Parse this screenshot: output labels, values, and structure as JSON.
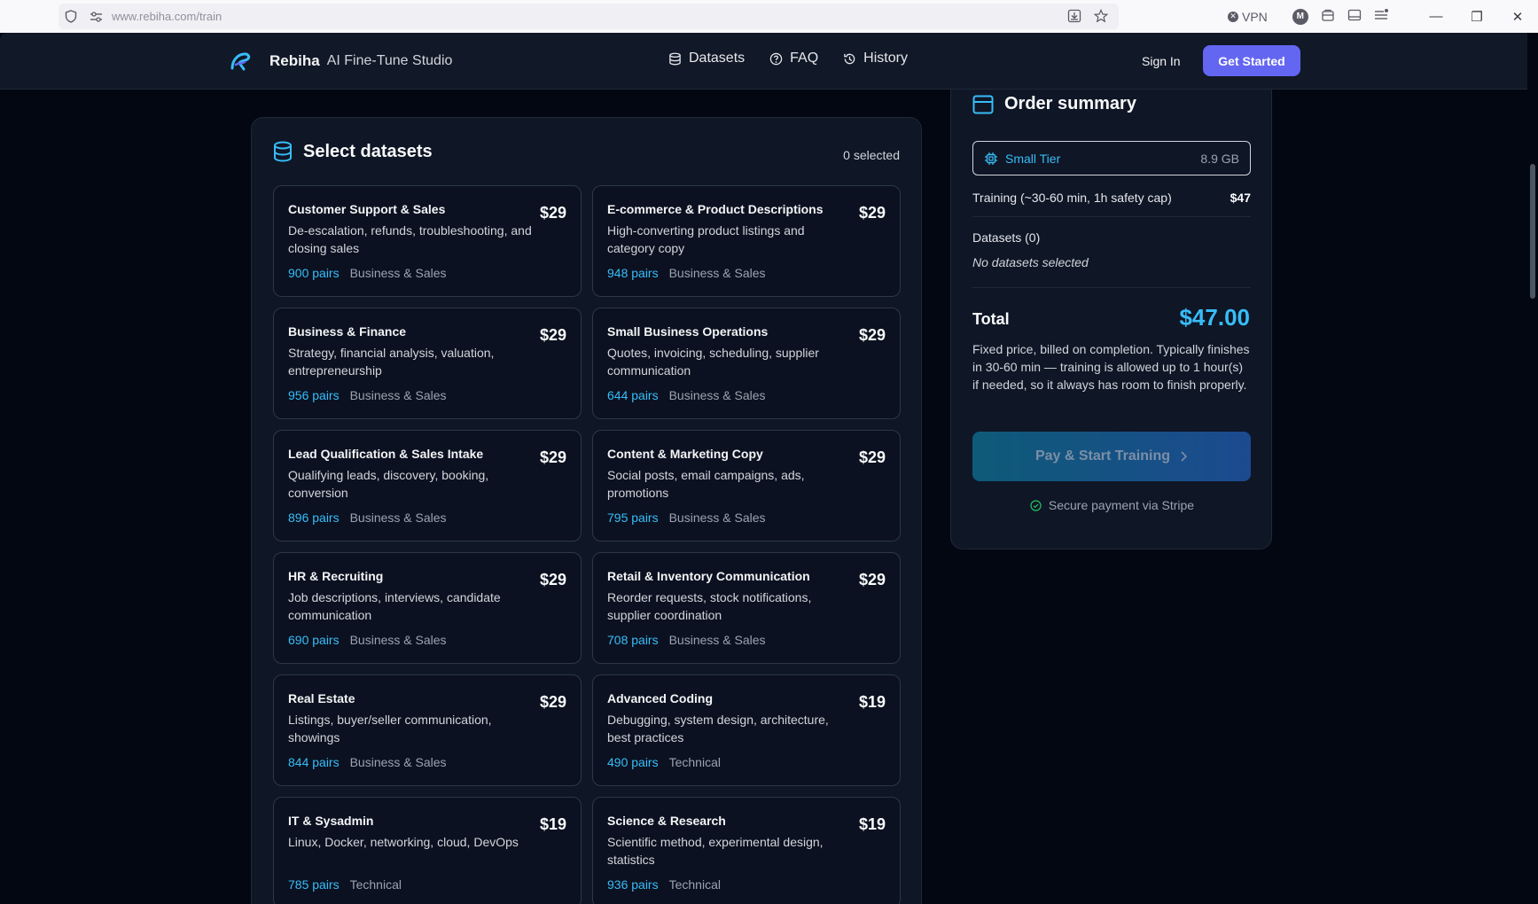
{
  "browser": {
    "url": "www.rebiha.com/train",
    "vpn_label": "VPN",
    "profile_initial": "M"
  },
  "nav": {
    "brand_name": "Rebiha",
    "brand_sub": "AI Fine-Tune Studio",
    "links": [
      {
        "label": "Datasets",
        "icon": "database-icon"
      },
      {
        "label": "FAQ",
        "icon": "help-circle-icon"
      },
      {
        "label": "History",
        "icon": "history-icon"
      }
    ],
    "sign_in": "Sign In",
    "get_started": "Get Started"
  },
  "datasets": {
    "title": "Select datasets",
    "selected_count": "0 selected",
    "cards": [
      {
        "title": "Customer Support & Sales",
        "price": "$29",
        "desc": "De-escalation, refunds, troubleshooting, and closing sales",
        "pairs": "900 pairs",
        "category": "Business & Sales"
      },
      {
        "title": "E-commerce & Product Descriptions",
        "price": "$29",
        "desc": "High-converting product listings and category copy",
        "pairs": "948 pairs",
        "category": "Business & Sales"
      },
      {
        "title": "Business & Finance",
        "price": "$29",
        "desc": "Strategy, financial analysis, valuation, entrepreneurship",
        "pairs": "956 pairs",
        "category": "Business & Sales"
      },
      {
        "title": "Small Business Operations",
        "price": "$29",
        "desc": "Quotes, invoicing, scheduling, supplier communication",
        "pairs": "644 pairs",
        "category": "Business & Sales"
      },
      {
        "title": "Lead Qualification & Sales Intake",
        "price": "$29",
        "desc": "Qualifying leads, discovery, booking, conversion",
        "pairs": "896 pairs",
        "category": "Business & Sales"
      },
      {
        "title": "Content & Marketing Copy",
        "price": "$29",
        "desc": "Social posts, email campaigns, ads, promotions",
        "pairs": "795 pairs",
        "category": "Business & Sales"
      },
      {
        "title": "HR & Recruiting",
        "price": "$29",
        "desc": "Job descriptions, interviews, candidate communication",
        "pairs": "690 pairs",
        "category": "Business & Sales"
      },
      {
        "title": "Retail & Inventory Communication",
        "price": "$29",
        "desc": "Reorder requests, stock notifications, supplier coordination",
        "pairs": "708 pairs",
        "category": "Business & Sales"
      },
      {
        "title": "Real Estate",
        "price": "$29",
        "desc": "Listings, buyer/seller communication, showings",
        "pairs": "844 pairs",
        "category": "Business & Sales"
      },
      {
        "title": "Advanced Coding",
        "price": "$19",
        "desc": "Debugging, system design, architecture, best practices",
        "pairs": "490 pairs",
        "category": "Technical"
      },
      {
        "title": "IT & Sysadmin",
        "price": "$19",
        "desc": "Linux, Docker, networking, cloud, DevOps",
        "pairs": "785 pairs",
        "category": "Technical"
      },
      {
        "title": "Science & Research",
        "price": "$19",
        "desc": "Scientific method, experimental design, statistics",
        "pairs": "936 pairs",
        "category": "Technical"
      }
    ]
  },
  "summary": {
    "title": "Order summary",
    "tier_name": "Small Tier",
    "tier_size": "8.9 GB",
    "training_label": "Training (~30-60 min, 1h safety cap)",
    "training_amount": "$47",
    "datasets_label": "Datasets (0)",
    "no_datasets": "No datasets selected",
    "total_label": "Total",
    "total_value": "$47.00",
    "fine_print": "Fixed price, billed on completion. Typically finishes in 30-60 min — training is allowed up to 1 hour(s) if needed, so it always has room to finish properly.",
    "pay_button": "Pay & Start Training",
    "secure_note": "Secure payment via Stripe"
  },
  "colors": {
    "accent": "#38bdf8",
    "primary_button": "#6366f1",
    "background": "#030712",
    "panel": "#0f1626"
  }
}
